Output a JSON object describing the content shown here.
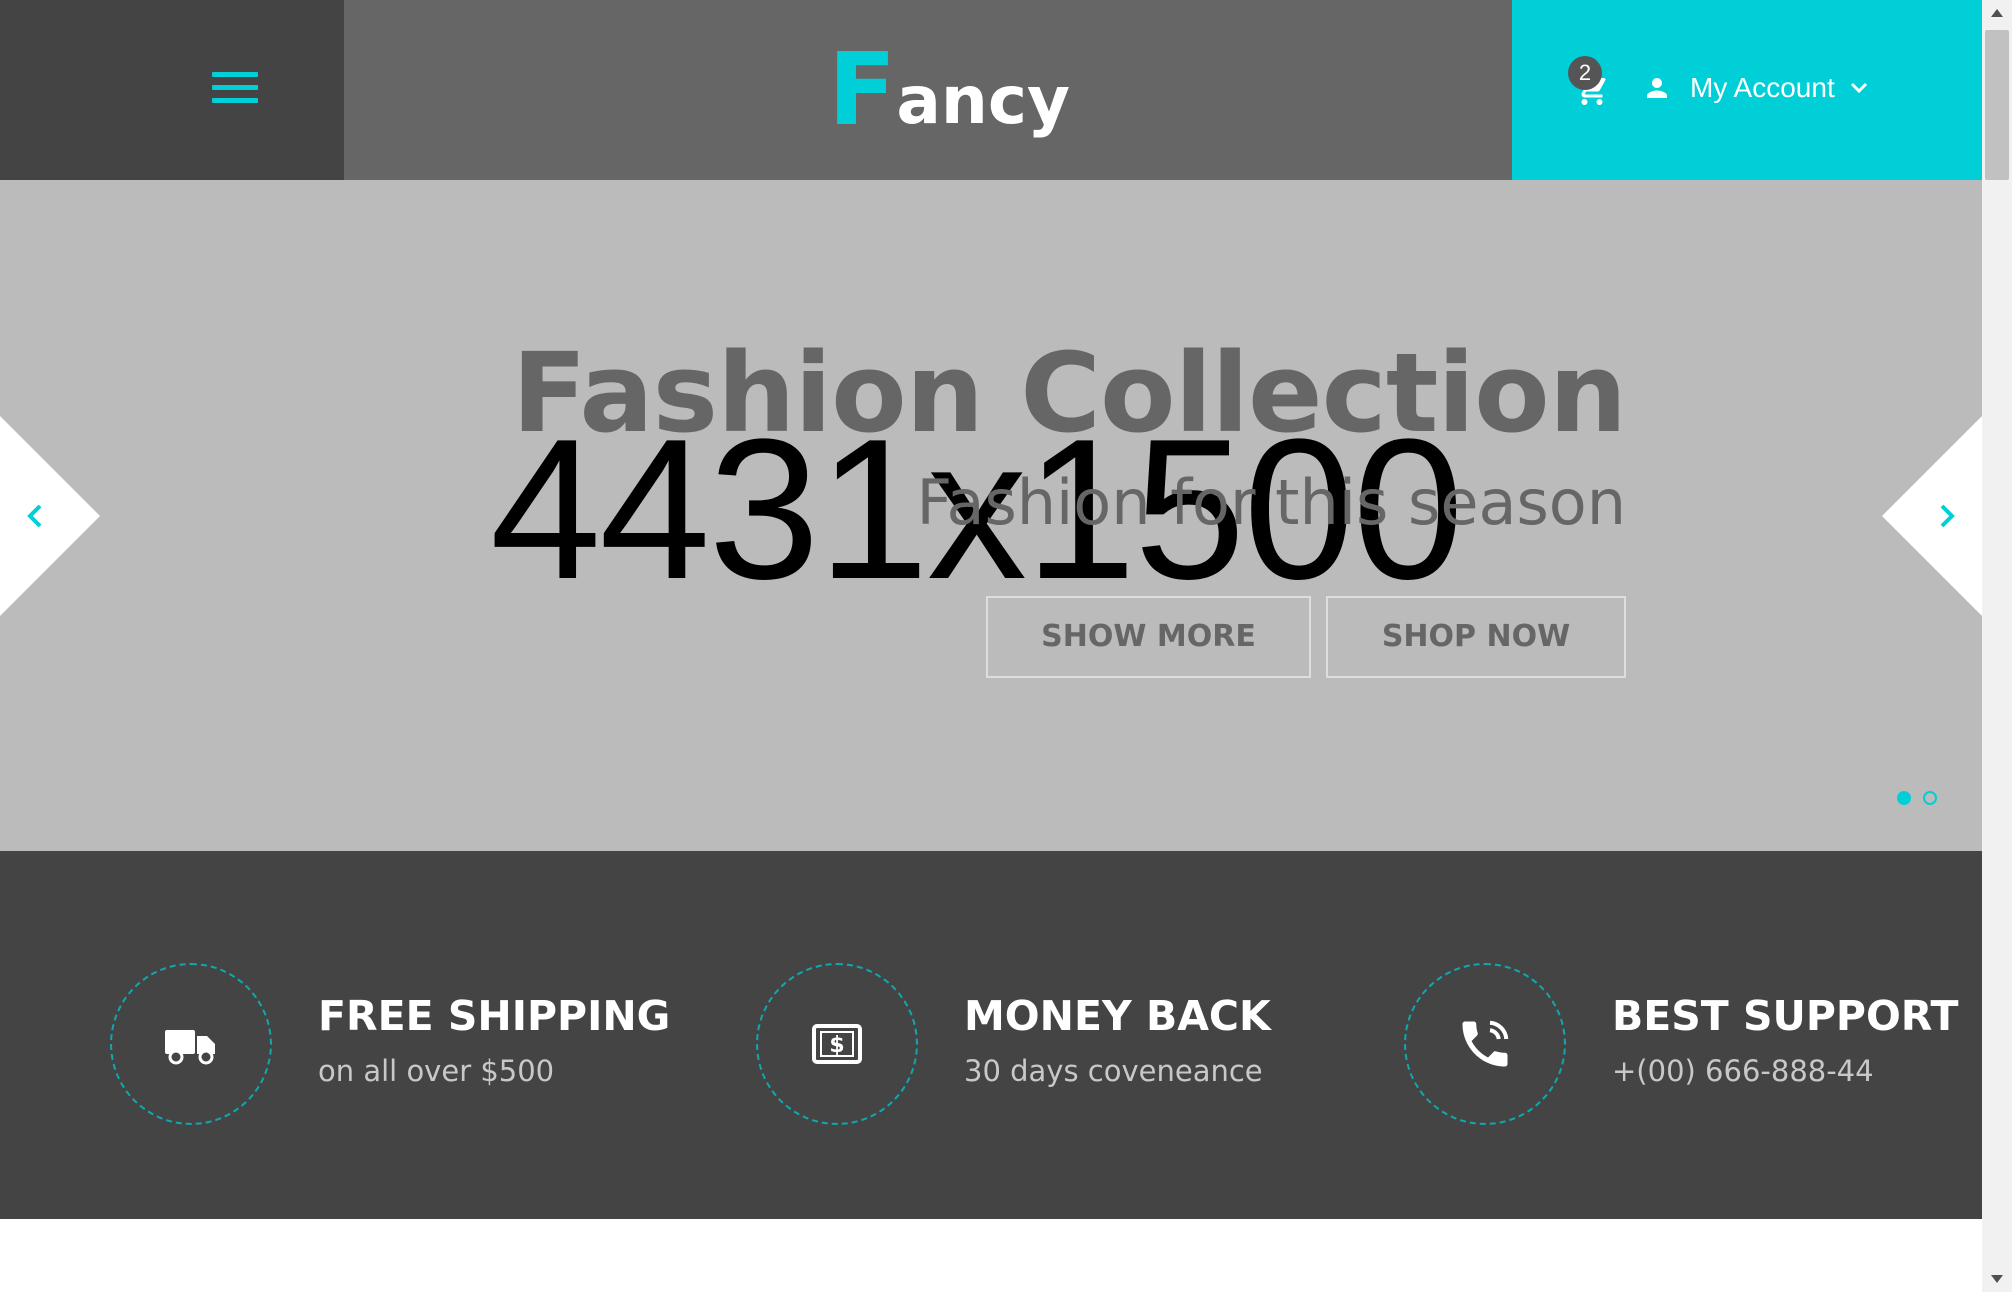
{
  "header": {
    "logo": {
      "first_letter": "F",
      "rest": "ancy"
    },
    "cart": {
      "count": "2",
      "icon": "cart-icon"
    },
    "account": {
      "label": "My Account",
      "icon": "user-icon"
    },
    "menu_icon": "hamburger-icon"
  },
  "hero": {
    "placeholder": "4431x1500",
    "title": "Fashion Collection",
    "subtitle": "Fashion for this season",
    "buttons": [
      {
        "label": "SHOW MORE"
      },
      {
        "label": "SHOP NOW"
      }
    ],
    "slides_total": 2,
    "active_slide": 1
  },
  "features": [
    {
      "title": "FREE SHIPPING",
      "subtitle": "on all over $500",
      "icon": "truck-icon"
    },
    {
      "title": "MONEY BACK",
      "subtitle": "30 days coveneance",
      "icon": "money-icon"
    },
    {
      "title": "BEST SUPPORT",
      "subtitle": "+(00) 666-888-44",
      "icon": "phone-icon"
    }
  ],
  "colors": {
    "accent": "#00cfd8",
    "header_left": "#444444",
    "header_center": "#666666",
    "hero_bg": "#bbbbbb",
    "features_bg": "#444444"
  }
}
